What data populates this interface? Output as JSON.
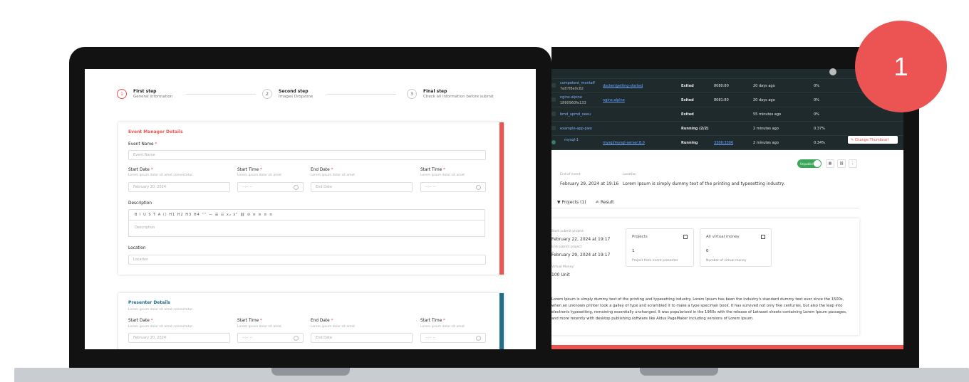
{
  "badge": {
    "number": "1"
  },
  "wizard": {
    "steps": [
      {
        "num": "1",
        "title": "First step",
        "subtitle": "General information"
      },
      {
        "num": "2",
        "title": "Second step",
        "subtitle": "Images Dropzone"
      },
      {
        "num": "3",
        "title": "Final step",
        "subtitle": "Check all information before submit"
      }
    ]
  },
  "event_card": {
    "title": "Event Manager Details",
    "event_name_label": "Event Name",
    "event_name_placeholder": "Event Name",
    "start_date_label": "Start Date",
    "start_date_sub": "Lorem ipsum dolor sit amet consectetur.",
    "start_date_value": "February 20, 2024",
    "start_time_label": "Start Time",
    "start_time_sub": "Lorem ipsum dolor sit amet",
    "start_time_value": "--:-- --",
    "end_date_label": "End Date",
    "end_date_sub": "Lorem ipsum dolor sit amet",
    "end_date_value": "End Date",
    "start_time2_label": "Start Time",
    "start_time2_sub": "Lorem ipsum dolor sit amet",
    "start_time2_value": "--:-- --",
    "description_label": "Description",
    "toolbar_text": "B  I  U  S  T  A  ⟨⟩   H1  H2  H3  H4   “”  —  ☰  ☷  x₂  x²   ⛓  ⊘   ≡  ≡  ≡  ≡",
    "description_placeholder": "Description",
    "location_label": "Location",
    "location_placeholder": "Location"
  },
  "presenter_card": {
    "title": "Presenter Details",
    "subtitle": "Lorem ipsum dolor sit amet consectetur.",
    "start_date_label": "Start Date",
    "start_date_sub": "Lorem ipsum dolor sit amet consectetur.",
    "start_date_value": "February 20, 2024",
    "start_time_label": "Start Time",
    "start_time_sub": "Lorem ipsum dolor sit amet",
    "start_time_value": "--:-- --",
    "end_date_label": "End Date",
    "end_date_sub": "Lorem ipsum dolor sit amet",
    "end_date_value": "End Date",
    "start_time2_label": "Start Time",
    "start_time2_sub": "Lorem ipsum dolor sit amet",
    "start_time2_value": "--:-- --"
  },
  "containers": {
    "rows": [
      {
        "name": "competent_montalf",
        "id": "7e87f8e0c82",
        "image": "docker/getting-started",
        "status": "Exited",
        "port": "8080:80",
        "created": "20 days ago",
        "cpu": "0%"
      },
      {
        "name": "nginx-alpine",
        "id": "1860960fe133",
        "image": "nginx:alpine",
        "status": "Exited",
        "port": "8081:80",
        "created": "20 days ago",
        "cpu": "0%"
      },
      {
        "name": "bmd_upmd_oeeu",
        "id": "",
        "image": "",
        "status": "Exited",
        "port": "",
        "created": "55 minutes ago",
        "cpu": "0%"
      },
      {
        "name": "example-app-pwo",
        "id": "",
        "image": "",
        "status": "Running (2/2)",
        "port": "",
        "created": "2 minutes ago",
        "cpu": "0.37%"
      },
      {
        "name": "mysql-1",
        "id": "",
        "image": "mysql/mysql-server:8.0",
        "status": "Running",
        "port": "3306:3306",
        "created": "2 minutes ago",
        "cpu": "0.34%"
      }
    ],
    "change_thumbnail": "Change Thumbnail"
  },
  "event_detail": {
    "toggle_label": "Unpublish",
    "end_label": "End of event",
    "end_value": "February 29, 2024 at 19:16",
    "location_label": "Location",
    "location_value": "Lorem Ipsum is simply dummy text of the printing and typesetting industry.",
    "tabs": [
      "Projects (1)",
      "Result"
    ],
    "left_col": [
      {
        "label": "Start submit project",
        "value": "February 22, 2024 at 19:17"
      },
      {
        "label": "End submit project",
        "value": "February 29, 2024 at 19:17"
      },
      {
        "label": "Virtual Money",
        "value": "100 Unit"
      }
    ],
    "stats": [
      {
        "title": "Projects",
        "value": "1",
        "desc": "Project from event presenter"
      },
      {
        "title": "All virtual money",
        "value": "0",
        "desc": "Number of virtual money"
      }
    ],
    "paragraph": "Lorem Ipsum is simply dummy text of the printing and typesetting industry. Lorem Ipsum has been the industry's standard dummy text ever since the 1500s, when an unknown printer took a galley of type and scrambled it to make a type specimen book. It has survived not only five centuries, but also the leap into electronic typesetting, remaining essentially unchanged. It was popularised in the 1960s with the release of Letraset sheets containing Lorem Ipsum passages, and more recently with desktop publishing software like Aldus PageMaker including versions of Lorem Ipsum."
  },
  "colors": {
    "accent": "#ef5350",
    "teal": "#1f6f8b",
    "badge": "#ec5454",
    "toggle": "#3aa657"
  }
}
